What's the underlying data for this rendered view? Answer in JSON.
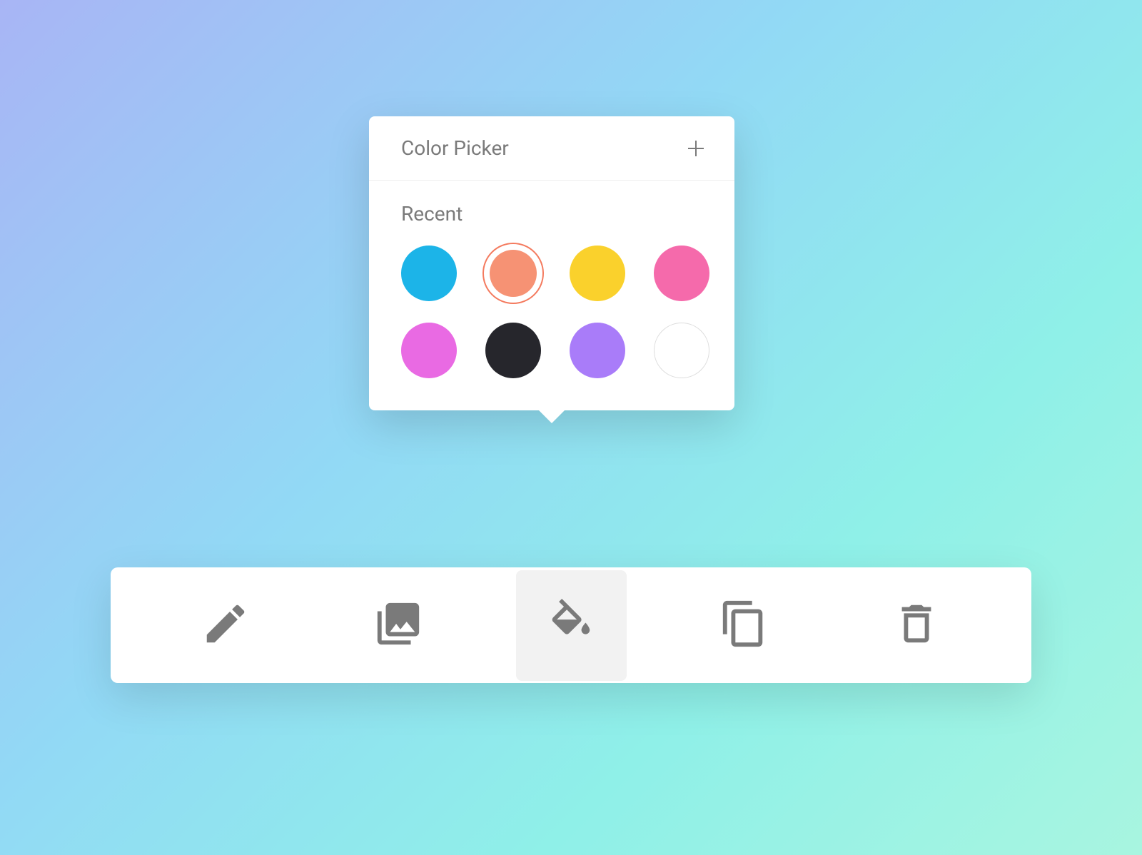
{
  "popover": {
    "title": "Color Picker",
    "recent_label": "Recent",
    "colors": [
      {
        "hex": "#1cb4e8",
        "name": "cyan",
        "selected": false
      },
      {
        "hex": "#f69274",
        "name": "coral",
        "selected": true
      },
      {
        "hex": "#fad12c",
        "name": "yellow",
        "selected": false
      },
      {
        "hex": "#f56aab",
        "name": "pink",
        "selected": false
      },
      {
        "hex": "#e96ae3",
        "name": "magenta",
        "selected": false
      },
      {
        "hex": "#26262c",
        "name": "black",
        "selected": false
      },
      {
        "hex": "#a97cf9",
        "name": "purple",
        "selected": false
      },
      {
        "hex": "#ffffff",
        "name": "white",
        "selected": false
      }
    ]
  },
  "toolbar": {
    "tools": [
      {
        "name": "edit",
        "icon": "pencil-icon",
        "active": false
      },
      {
        "name": "images",
        "icon": "images-icon",
        "active": false
      },
      {
        "name": "fill",
        "icon": "paint-bucket-icon",
        "active": true
      },
      {
        "name": "copy",
        "icon": "copy-icon",
        "active": false
      },
      {
        "name": "delete",
        "icon": "trash-icon",
        "active": false
      }
    ]
  }
}
